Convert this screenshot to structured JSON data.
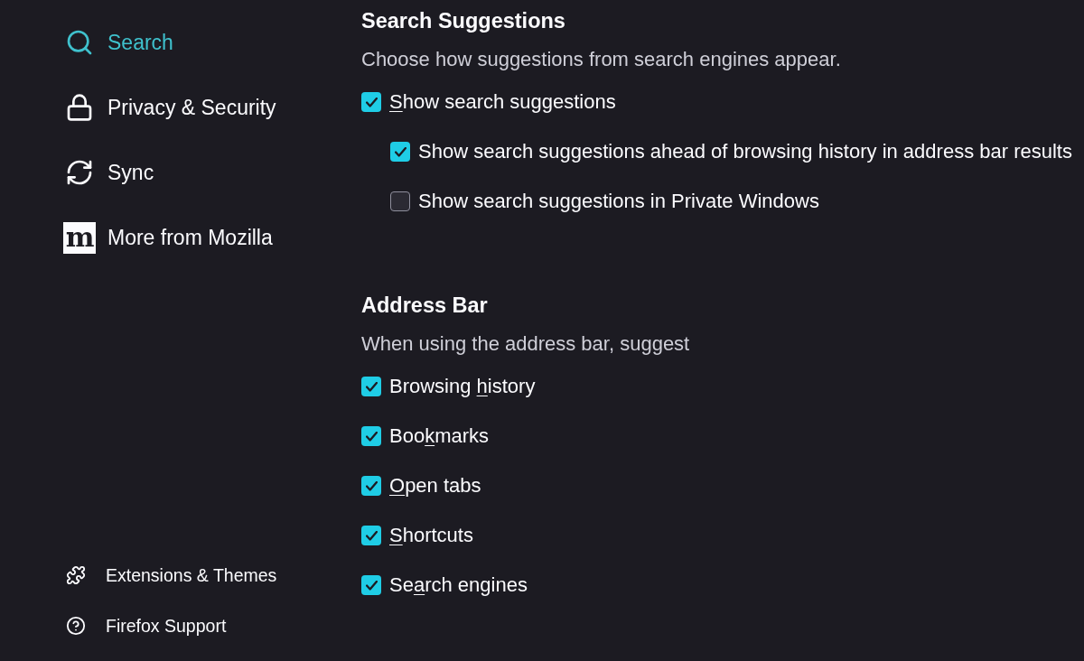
{
  "sidebar": {
    "categories": [
      {
        "label": "Search",
        "selected": true
      },
      {
        "label": "Privacy & Security",
        "selected": false
      },
      {
        "label": "Sync",
        "selected": false
      },
      {
        "label": "More from Mozilla",
        "selected": false,
        "logo_text": "m"
      }
    ],
    "links": [
      {
        "label": "Extensions & Themes"
      },
      {
        "label": "Firefox Support"
      }
    ]
  },
  "sections": [
    {
      "title": "Search Suggestions",
      "description": "Choose how suggestions from search engines appear.",
      "options": [
        {
          "label": [
            {
              "text": "S",
              "access_key": true
            },
            {
              "text": "how search suggestions",
              "access_key": false
            }
          ],
          "checked": true,
          "children": [
            {
              "label": [
                {
                  "text": "Show search suggestions ahead of browsing history in address bar results",
                  "access_key": false
                }
              ],
              "checked": true
            },
            {
              "label": [
                {
                  "text": "Show search suggestions in Private Windows",
                  "access_key": false
                }
              ],
              "checked": false
            }
          ]
        }
      ]
    },
    {
      "title": "Address Bar",
      "description": "When using the address bar, suggest",
      "options": [
        {
          "label": [
            {
              "text": "Browsing ",
              "access_key": false
            },
            {
              "text": "h",
              "access_key": true
            },
            {
              "text": "istory",
              "access_key": false
            }
          ],
          "checked": true
        },
        {
          "label": [
            {
              "text": "Boo",
              "access_key": false
            },
            {
              "text": "k",
              "access_key": true
            },
            {
              "text": "marks",
              "access_key": false
            }
          ],
          "checked": true
        },
        {
          "label": [
            {
              "text": "O",
              "access_key": true
            },
            {
              "text": "pen tabs",
              "access_key": false
            }
          ],
          "checked": true
        },
        {
          "label": [
            {
              "text": "S",
              "access_key": true
            },
            {
              "text": "hortcuts",
              "access_key": false
            }
          ],
          "checked": true
        },
        {
          "label": [
            {
              "text": "Se",
              "access_key": false
            },
            {
              "text": "a",
              "access_key": true
            },
            {
              "text": "rch engines",
              "access_key": false
            }
          ],
          "checked": true
        }
      ]
    }
  ]
}
